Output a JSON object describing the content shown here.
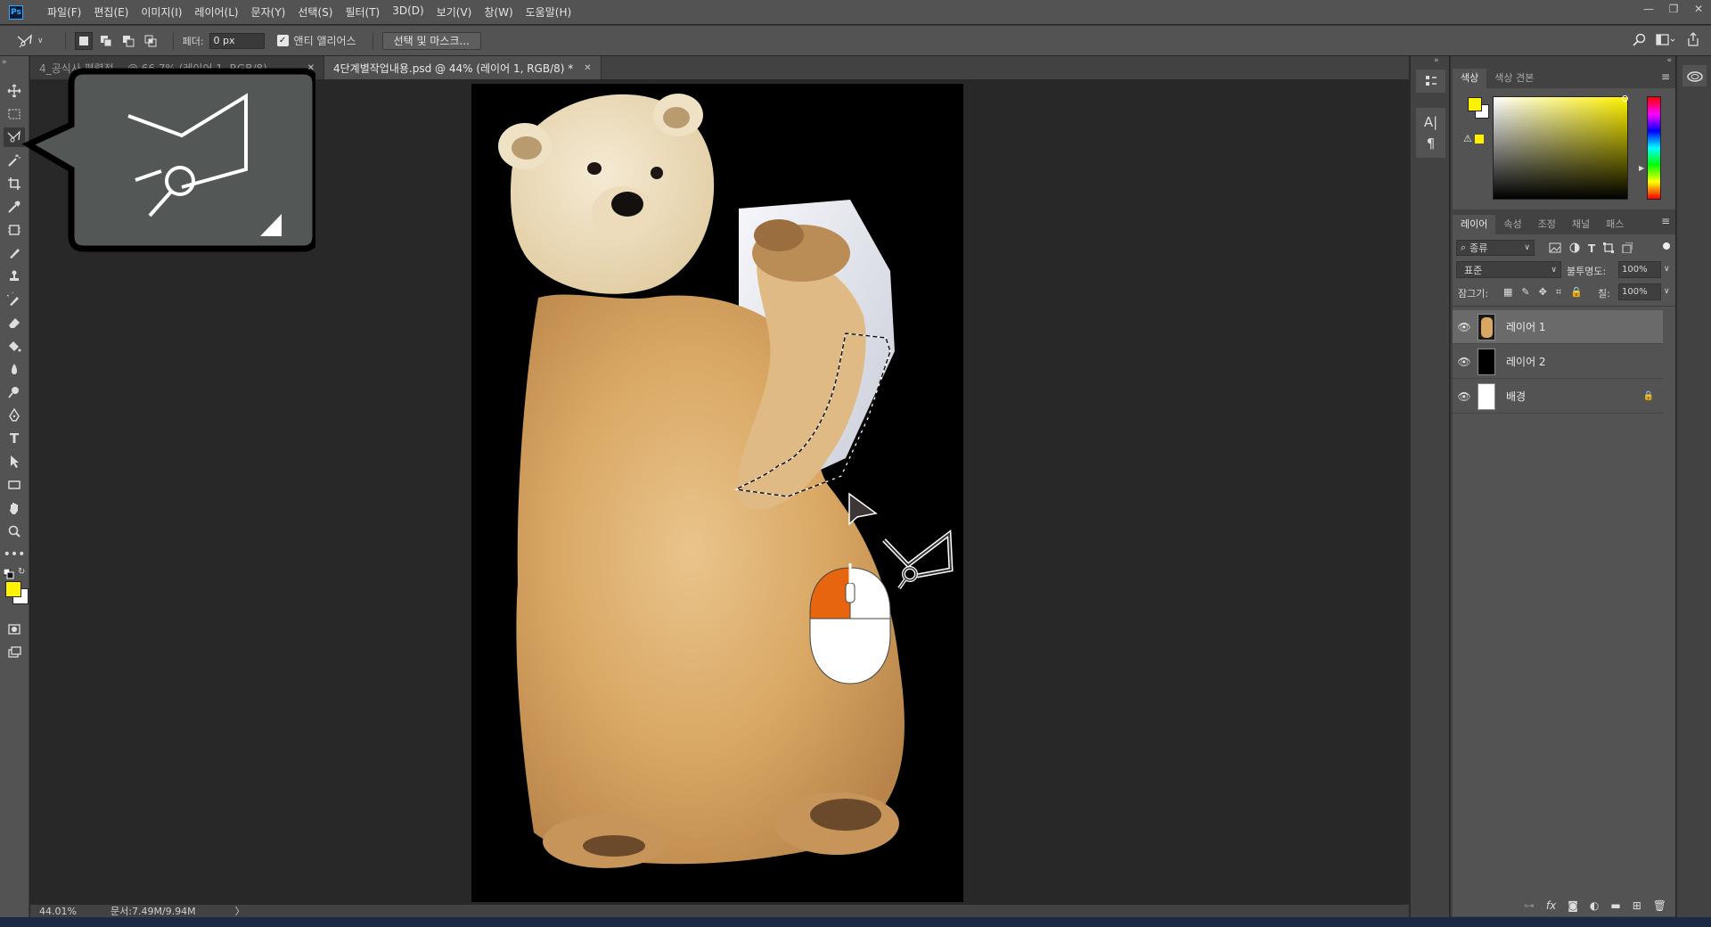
{
  "app": {
    "logo": "Ps"
  },
  "menu": [
    "파일(F)",
    "편집(E)",
    "이미지(I)",
    "레이어(L)",
    "문자(Y)",
    "선택(S)",
    "필터(T)",
    "3D(D)",
    "보기(V)",
    "창(W)",
    "도움말(H)"
  ],
  "options": {
    "feather_label": "페더:",
    "feather_value": "0 px",
    "antialias_label": "앤티 앨리어스",
    "antialias_checked": true,
    "select_mask_label": "선택 및 마스크..."
  },
  "tabs": [
    {
      "label": "4_공식사 평렬점  ...@ 66.7% (레이어 1, RGB/8)",
      "active": false
    },
    {
      "label": "4단계별작업내용.psd @ 44% (레이어 1, RGB/8) *",
      "active": true
    }
  ],
  "status": {
    "zoom": "44.01%",
    "doc_info": "문서:7.49M/9.94M",
    "arrow": "〉"
  },
  "colors": {
    "foreground": "#fff200",
    "background": "#ffffff",
    "accent": "#e8650f"
  },
  "color_panel": {
    "tabs": [
      "색상",
      "색상 견본"
    ],
    "active_tab": 0
  },
  "layers_panel": {
    "tabs": [
      "레이어",
      "속성",
      "조정",
      "채널",
      "패스"
    ],
    "active_tab": 0,
    "filter_label": "종류",
    "blend_mode": "표준",
    "opacity_label": "불투명도:",
    "opacity_value": "100%",
    "lock_label": "잠그기:",
    "fill_label": "칠:",
    "fill_value": "100%",
    "layers": [
      {
        "name": "레이어 1",
        "selected": true,
        "locked": false,
        "thumb": "bear"
      },
      {
        "name": "레이어 2",
        "selected": false,
        "locked": false,
        "thumb": "black"
      },
      {
        "name": "배경",
        "selected": false,
        "locked": true,
        "thumb": "white"
      }
    ]
  },
  "callout": {
    "icon": "polygonal-lasso-icon"
  }
}
